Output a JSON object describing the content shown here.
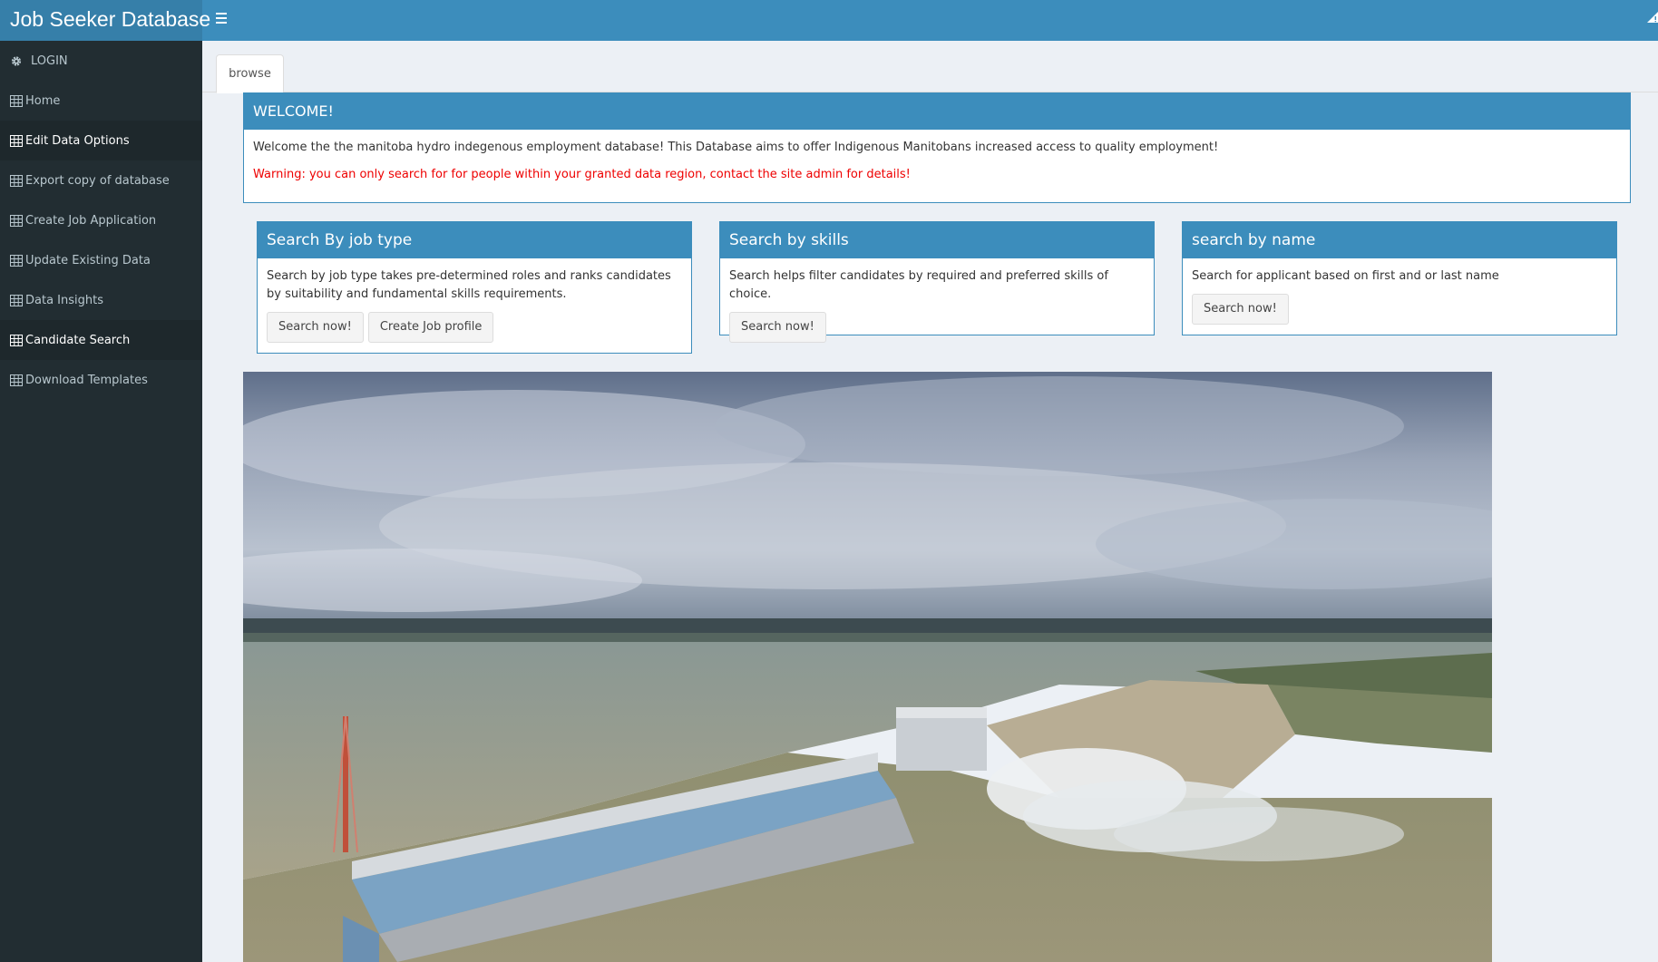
{
  "header": {
    "app_title": "Job Seeker Database",
    "menu_icon": "hamburger-icon",
    "alert_icon": "warning-icon",
    "brand_color": "#3c8dbc"
  },
  "sidebar": {
    "items": [
      {
        "label": "LOGIN",
        "icon": "gear-icon",
        "active": false
      },
      {
        "label": "Home",
        "icon": "table-icon",
        "active": false
      },
      {
        "label": "Edit Data Options",
        "icon": "table-icon",
        "active": true
      },
      {
        "label": "Export copy of database",
        "icon": "table-icon",
        "active": false
      },
      {
        "label": "Create Job Application",
        "icon": "table-icon",
        "active": false
      },
      {
        "label": "Update Existing Data",
        "icon": "table-icon",
        "active": false
      },
      {
        "label": "Data Insights",
        "icon": "table-icon",
        "active": false
      },
      {
        "label": "Candidate Search",
        "icon": "table-icon",
        "active": true
      },
      {
        "label": "Download Templates",
        "icon": "table-icon",
        "active": false
      }
    ]
  },
  "tabs": [
    {
      "label": "browse"
    }
  ],
  "welcome": {
    "title": "WELCOME!",
    "text": "Welcome the the manitoba hydro indegenous employment database! This Database aims to offer Indigenous Manitobans increased access to quality employment!",
    "warning": "Warning: you can only search for for people within your granted data region, contact the site admin for details!",
    "warning_color": "#ee0000"
  },
  "cards": {
    "job_type": {
      "title": "Search By job type",
      "desc": "Search by job type takes pre-determined roles and ranks candidates by suitability and fundamental skills requirements.",
      "search_btn": "Search now!",
      "create_btn": "Create Job profile"
    },
    "skills": {
      "title": "Search by skills",
      "desc": "Search helps filter candidates by required and preferred skills of choice.",
      "search_btn": "Search now!"
    },
    "name": {
      "title": "search by name",
      "desc": "Search for applicant based on first and or last name",
      "search_btn": "Search now!"
    }
  },
  "hero": {
    "image": "hydroelectric-dam-photo"
  }
}
